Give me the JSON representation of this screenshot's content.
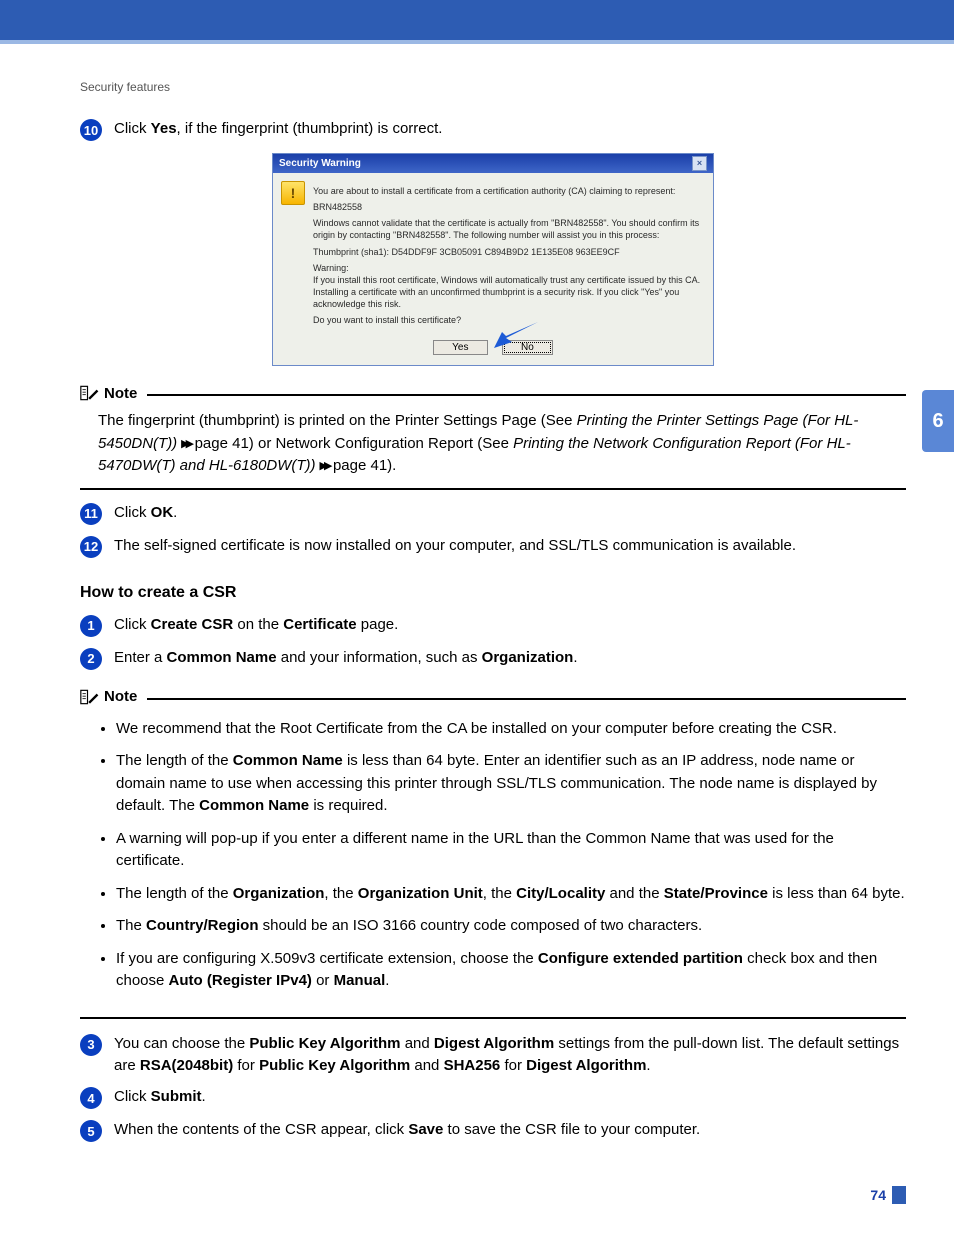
{
  "header": {
    "section_title": "Security features"
  },
  "side_tab": {
    "chapter": "6"
  },
  "footer": {
    "page_number": "74"
  },
  "steps_a": {
    "s10": {
      "num": "10",
      "pre": "Click ",
      "bold": "Yes",
      "post": ", if the fingerprint (thumbprint) is correct."
    },
    "s11": {
      "num": "11",
      "pre": "Click ",
      "bold": "OK",
      "post": "."
    },
    "s12": {
      "num": "12",
      "text": "The self-signed certificate is now installed on your computer, and SSL/TLS communication is available."
    }
  },
  "dialog": {
    "title": "Security Warning",
    "close": "×",
    "warn_icon": "!",
    "p1": "You are about to install a certificate from a certification authority (CA) claiming to represent:",
    "p2": "BRN482558",
    "p3": "Windows cannot validate that the certificate is actually from \"BRN482558\". You should confirm its origin by contacting \"BRN482558\". The following number will assist you in this process:",
    "p4": "Thumbprint (sha1): D54DDF9F 3CB05091 C894B9D2 1E135E08 963EE9CF",
    "p5a": "Warning:",
    "p5b": "If you install this root certificate, Windows will automatically trust any certificate issued by this CA. Installing a certificate with an unconfirmed thumbprint is a security risk. If you click \"Yes\" you acknowledge this risk.",
    "p6": "Do you want to install this certificate?",
    "btn_yes": "Yes",
    "btn_no": "No"
  },
  "note1": {
    "label": "Note",
    "t1": "The fingerprint (thumbprint) is printed on the Printer Settings Page (See ",
    "i1": "Printing the Printer Settings Page (For HL-5450DN(T))",
    "t2": " ",
    "chev1": "▸▸",
    "t3": " page 41) or Network Configuration Report (See ",
    "i2": "Printing the Network Configuration Report  (For HL-5470DW(T) and HL-6180DW(T))",
    "t4": " ",
    "chev2": "▸▸",
    "t5": " page 41)."
  },
  "csr": {
    "heading": "How to create a CSR",
    "s1": {
      "num": "1",
      "t1": "Click ",
      "b1": "Create CSR",
      "t2": " on the ",
      "b2": "Certificate",
      "t3": " page."
    },
    "s2": {
      "num": "2",
      "t1": "Enter a ",
      "b1": "Common Name",
      "t2": " and your information, such as ",
      "b2": "Organization",
      "t3": "."
    },
    "s3": {
      "num": "3",
      "t1": "You can choose the ",
      "b1": "Public Key Algorithm",
      "t2": " and ",
      "b2": "Digest Algorithm",
      "t3": " settings from the pull-down list. The default settings are ",
      "b3": "RSA(2048bit)",
      "t4": " for ",
      "b4": "Public Key Algorithm",
      "t5": " and ",
      "b5": "SHA256",
      "t6": " for ",
      "b6": "Digest Algorithm",
      "t7": "."
    },
    "s4": {
      "num": "4",
      "t1": "Click ",
      "b1": "Submit",
      "t2": "."
    },
    "s5": {
      "num": "5",
      "t1": "When the contents of the CSR appear, click ",
      "b1": "Save",
      "t2": " to save the CSR file to your computer."
    }
  },
  "note2": {
    "label": "Note",
    "li1": "We recommend that the Root Certificate from the CA be installed on your computer before creating the CSR.",
    "li2": {
      "t1": "The length of the ",
      "b1": "Common Name",
      "t2": " is less than 64 byte. Enter an identifier such as an IP address, node name or domain name to use when accessing this printer through SSL/TLS communication. The node name is displayed by default. The ",
      "b2": "Common Name",
      "t3": " is required."
    },
    "li3": "A warning will pop-up if you enter a different name in the URL than the Common Name that was used for the certificate.",
    "li4": {
      "t1": "The length of the ",
      "b1": "Organization",
      "t2": ", the ",
      "b2": "Organization Unit",
      "t3": ", the ",
      "b3": "City/Locality",
      "t4": " and the ",
      "b4": "State/Province",
      "t5": " is less than 64 byte."
    },
    "li5": {
      "t1": "The ",
      "b1": "Country/Region",
      "t2": " should be an ISO 3166 country code composed of two characters."
    },
    "li6": {
      "t1": "If you are configuring X.509v3 certificate extension, choose the ",
      "b1": "Configure extended partition",
      "t2": " check box and then choose ",
      "b2": "Auto (Register IPv4)",
      "t3": " or ",
      "b3": "Manual",
      "t4": "."
    }
  }
}
